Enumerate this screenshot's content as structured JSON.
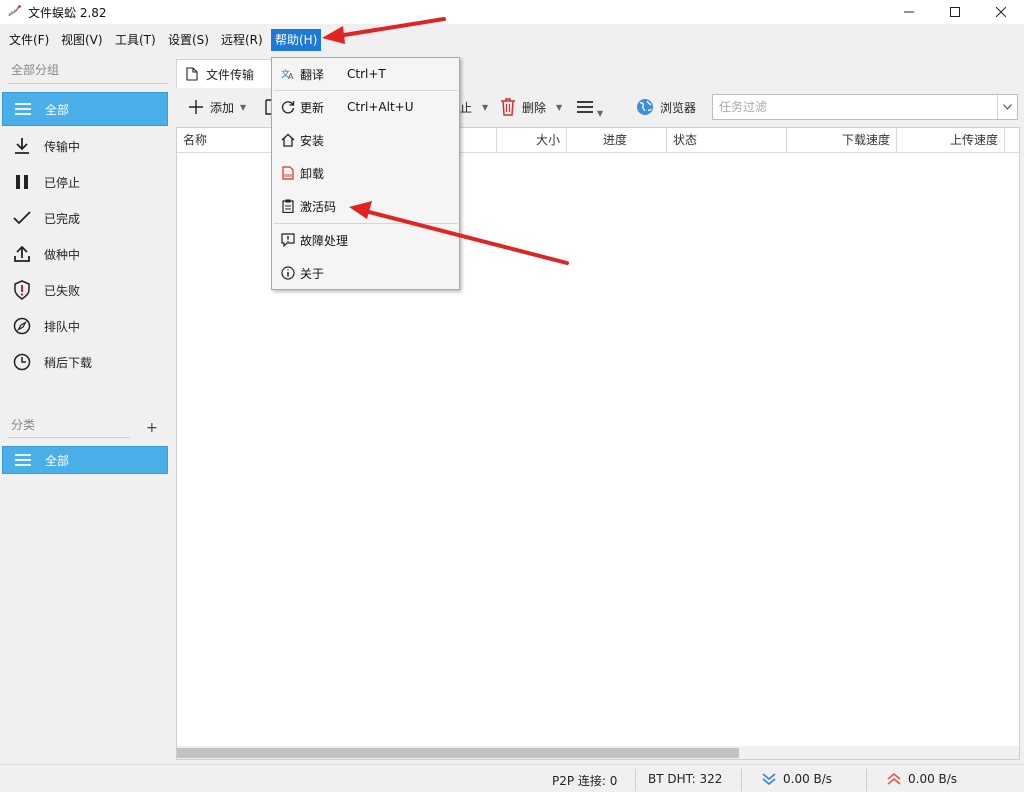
{
  "window": {
    "title": "文件蜈蚣 2.82",
    "icon": "centipede-icon"
  },
  "menubar": {
    "items": [
      "文件(F)",
      "视图(V)",
      "工具(T)",
      "设置(S)",
      "远程(R)",
      "帮助(H)"
    ],
    "active_index": 5
  },
  "sidebar": {
    "group_header": "全部分组",
    "groups": [
      {
        "label": "全部",
        "icon": "list-icon",
        "selected": true
      },
      {
        "label": "传输中",
        "icon": "download-icon"
      },
      {
        "label": "已停止",
        "icon": "pause-icon"
      },
      {
        "label": "已完成",
        "icon": "check-icon"
      },
      {
        "label": "做种中",
        "icon": "upload-icon"
      },
      {
        "label": "已失败",
        "icon": "shield-alert-icon"
      },
      {
        "label": "排队中",
        "icon": "compass-icon"
      },
      {
        "label": "稍后下载",
        "icon": "clock-icon"
      }
    ],
    "category_header": "分类",
    "add_label": "+",
    "categories": [
      {
        "label": "全部",
        "icon": "list-icon",
        "selected": true
      }
    ]
  },
  "main": {
    "tab_label": "文件传输",
    "toolbar": {
      "add_label": "添加",
      "stop_partial": "止",
      "delete_label": "删除",
      "browser_label": "浏览器",
      "filter_placeholder": "任务过滤"
    },
    "columns": [
      "名称",
      "大小",
      "进度",
      "状态",
      "下载速度",
      "上传速度"
    ]
  },
  "dropdown": {
    "items": [
      {
        "label": "翻译",
        "shortcut": "Ctrl+T",
        "icon": "translate-icon"
      },
      {
        "label": "更新",
        "shortcut": "Ctrl+Alt+U",
        "icon": "refresh-icon"
      },
      {
        "label": "安装",
        "shortcut": "",
        "icon": "home-icon"
      },
      {
        "label": "卸载",
        "shortcut": "",
        "icon": "uninstall-icon"
      },
      {
        "label": "激活码",
        "shortcut": "",
        "icon": "clipboard-icon"
      },
      {
        "label": "故障处理",
        "shortcut": "",
        "icon": "troubleshoot-icon"
      },
      {
        "label": "关于",
        "shortcut": "",
        "icon": "info-icon"
      }
    ]
  },
  "statusbar": {
    "p2p": "P2P 连接:  0",
    "dht": "BT DHT:  322",
    "down_speed": "0.00 B/s",
    "up_speed": "0.00 B/s"
  },
  "colors": {
    "accent": "#1e78d7",
    "sidebar_selected": "#4aaee8",
    "annotation_arrow": "#e02424",
    "download_speed": "#2f7fd8",
    "upload_speed": "#e05050"
  }
}
